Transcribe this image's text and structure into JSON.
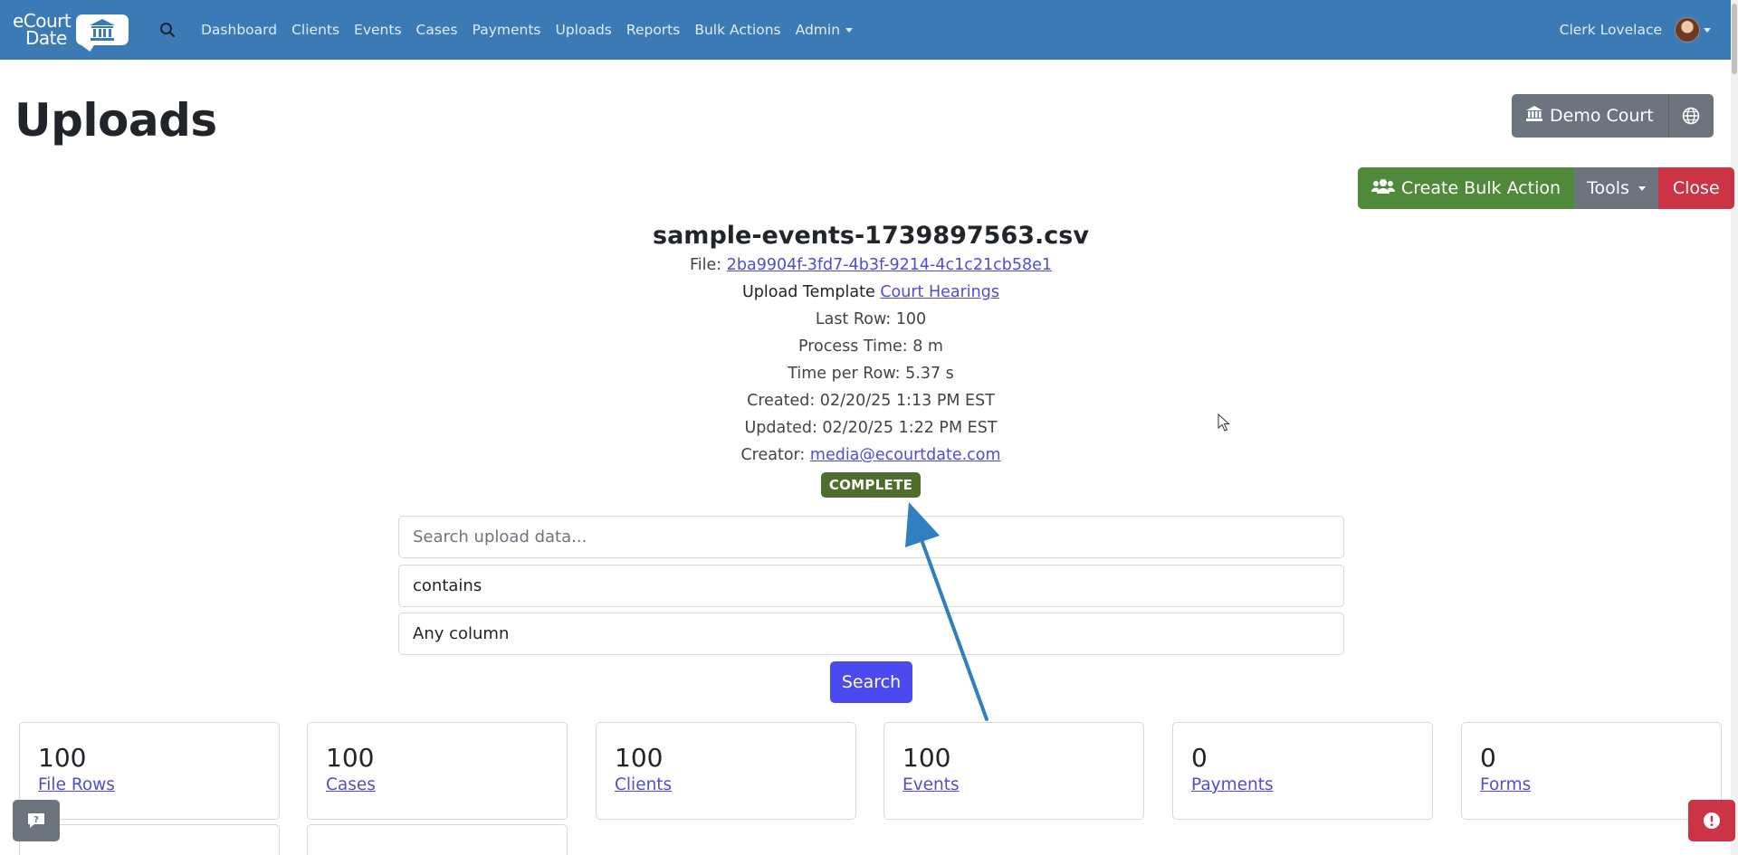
{
  "brand": {
    "line1": "eCourt",
    "line2": "Date"
  },
  "nav": {
    "items": [
      "Dashboard",
      "Clients",
      "Events",
      "Cases",
      "Payments",
      "Uploads",
      "Reports",
      "Bulk Actions"
    ],
    "admin": "Admin",
    "user": "Clerk Lovelace"
  },
  "header": {
    "title": "Uploads",
    "court_button": "Demo Court",
    "create_bulk_action": "Create Bulk Action",
    "tools": "Tools",
    "close": "Close"
  },
  "upload": {
    "file_name": "sample-events-1739897563.csv",
    "file_label": "File:",
    "file_id": "2ba9904f-3fd7-4b3f-9214-4c1c21cb58e1",
    "template_label": "Upload Template",
    "template_name": "Court Hearings",
    "last_row": "Last Row: 100",
    "process_time": "Process Time: 8 m",
    "time_per_row": "Time per Row: 5.37 s",
    "created": "Created: 02/20/25 1:13 PM EST",
    "updated": "Updated: 02/20/25 1:22 PM EST",
    "creator_label": "Creator:",
    "creator_email": "media@ecourtdate.com",
    "status": "COMPLETE",
    "status_color": "#4e6e2e"
  },
  "search": {
    "placeholder": "Search upload data...",
    "operator": "contains",
    "column": "Any column",
    "button": "Search"
  },
  "stats": [
    {
      "value": "100",
      "label": "File Rows"
    },
    {
      "value": "100",
      "label": "Cases"
    },
    {
      "value": "100",
      "label": "Clients"
    },
    {
      "value": "100",
      "label": "Events"
    },
    {
      "value": "0",
      "label": "Payments"
    },
    {
      "value": "0",
      "label": "Forms"
    }
  ],
  "colors": {
    "navbar": "#3b7ab5",
    "success": "#4e8a3a",
    "secondary": "#6c757d",
    "danger": "#cc3344",
    "primary": "#4a4af0",
    "annotation_arrow": "#2f7fc1"
  },
  "icons": [
    "search-icon",
    "courthouse-icon",
    "globe-icon",
    "users-icon",
    "chat-help-icon",
    "alert-icon"
  ]
}
